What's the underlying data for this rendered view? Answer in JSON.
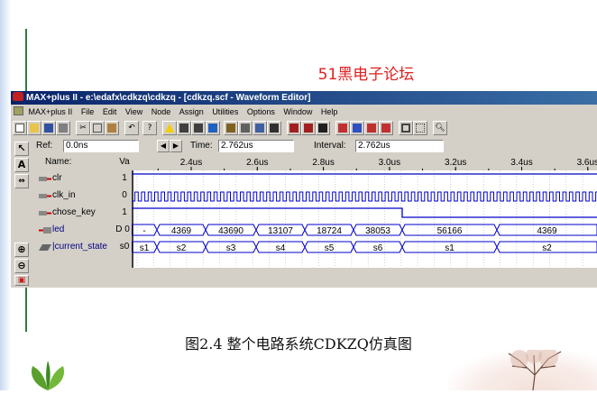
{
  "watermark": "51黑电子论坛",
  "window": {
    "title": "MAX+plus II - e:\\edafx\\cdkzq\\cdkzq - [cdkzq.scf - Waveform Editor]"
  },
  "menu": [
    "MAX+plus II",
    "File",
    "Edit",
    "View",
    "Node",
    "Assign",
    "Utilities",
    "Options",
    "Window",
    "Help"
  ],
  "timebar": {
    "ref_label": "Ref:",
    "ref_value": "0.0ns",
    "time_label": "Time:",
    "time_value": "2.762us",
    "interval_label": "Interval:",
    "interval_value": "2.762us"
  },
  "columns": {
    "name": "Name:",
    "value": "Va"
  },
  "ruler": [
    "2.4us",
    "2.6us",
    "2.8us",
    "3.0us",
    "3.2us",
    "3.4us",
    "3.6us"
  ],
  "signals": [
    {
      "name": "clr",
      "value": "1"
    },
    {
      "name": "clk_in",
      "value": "0"
    },
    {
      "name": "chose_key",
      "value": "1"
    },
    {
      "name": "led",
      "value": "D 0"
    },
    {
      "name": "|current_state",
      "value": "s0"
    }
  ],
  "bus_led": [
    "-",
    "4369",
    "43690",
    "13107",
    "18724",
    "38053",
    "56166",
    "4369"
  ],
  "bus_state": [
    "s1",
    "s2",
    "s3",
    "s4",
    "s5",
    "s6",
    "s1",
    "s2"
  ],
  "caption": "图2.4  整个电路系统CDKZQ仿真图",
  "colors": {
    "wave": "#0000cc",
    "title_start": "#0a246a",
    "title_end": "#3a6ea5",
    "watermark": "#e02020"
  }
}
